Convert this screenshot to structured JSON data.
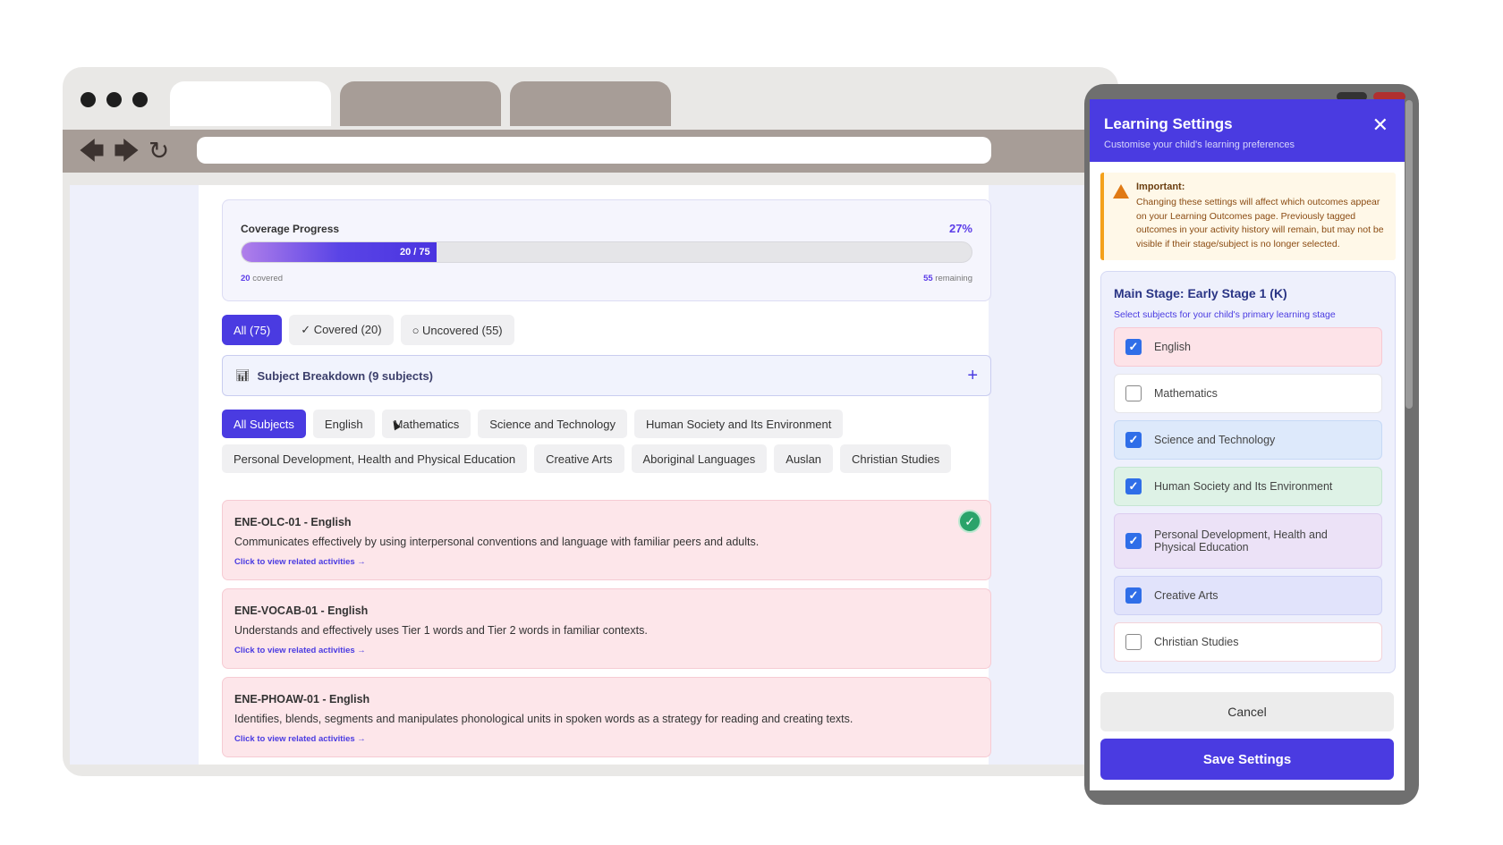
{
  "browser": {
    "nav_icons": {
      "back": "back-arrow-icon",
      "forward": "forward-arrow-icon",
      "reload": "reload-icon"
    }
  },
  "progress": {
    "title": "Coverage Progress",
    "percent_label": "27%",
    "bar_label": "20 / 75",
    "covered": 20,
    "total": 75,
    "covered_count": "20",
    "covered_text": "covered",
    "remaining_count": "55",
    "remaining_text": "remaining"
  },
  "filters": [
    {
      "label": "All (75)",
      "selected": true
    },
    {
      "label": "✓ Covered (20)",
      "selected": false
    },
    {
      "label": "○ Uncovered (55)",
      "selected": false
    }
  ],
  "breakdown": {
    "label": "Subject Breakdown (9 subjects)",
    "icon": "bar-chart-icon",
    "expand_icon": "plus-icon"
  },
  "subjects": [
    {
      "label": "All Subjects",
      "selected": true
    },
    {
      "label": "English"
    },
    {
      "label": "Mathematics"
    },
    {
      "label": "Science and Technology"
    },
    {
      "label": "Human Society and Its Environment"
    },
    {
      "label": "Personal Development, Health and Physical Education"
    },
    {
      "label": "Creative Arts"
    },
    {
      "label": "Aboriginal Languages"
    },
    {
      "label": "Auslan"
    },
    {
      "label": "Christian Studies"
    }
  ],
  "outcomes": [
    {
      "code": "ENE-OLC-01 - English",
      "description": "Communicates effectively by using interpersonal conventions and language with familiar peers and adults.",
      "link": "Click to view related activities →",
      "covered": true
    },
    {
      "code": "ENE-VOCAB-01 - English",
      "description": "Understands and effectively uses Tier 1 words and Tier 2 words in familiar contexts.",
      "link": "Click to view related activities →",
      "covered": false
    },
    {
      "code": "ENE-PHOAW-01 - English",
      "description": "Identifies, blends, segments and manipulates phonological units in spoken words as a strategy for reading and creating texts.",
      "link": "Click to view related activities →",
      "covered": false
    }
  ],
  "modal": {
    "title": "Learning Settings",
    "subtitle": "Customise your child's learning preferences",
    "warning_title": "Important:",
    "warning_text": "Changing these settings will affect which outcomes appear on your Learning Outcomes page. Previously tagged outcomes in your activity history will remain, but may not be visible if their stage/subject is no longer selected.",
    "stage_title": "Main Stage: Early Stage 1 (K)",
    "stage_subtitle": "Select subjects for your child's primary learning stage",
    "items": [
      {
        "label": "English",
        "checked": true,
        "bg": "#fde3e8",
        "border": "#f7c9d3"
      },
      {
        "label": "Mathematics",
        "checked": false,
        "bg": "#ffffff",
        "border": "#e5e5ea"
      },
      {
        "label": "Science and Technology",
        "checked": true,
        "bg": "#dde9fb",
        "border": "#c6d9f6"
      },
      {
        "label": "Human Society and Its Environment",
        "checked": true,
        "bg": "#def2e6",
        "border": "#c5e5d2"
      },
      {
        "label": "Personal Development, Health and Physical Education",
        "checked": true,
        "bg": "#ece2f7",
        "border": "#dccdf0"
      },
      {
        "label": "Creative Arts",
        "checked": true,
        "bg": "#e1e3fb",
        "border": "#cdd1f5"
      },
      {
        "label": "Christian Studies",
        "checked": false,
        "bg": "#ffffff",
        "border": "#f3d3d9"
      }
    ],
    "cancel_label": "Cancel",
    "save_label": "Save Settings"
  },
  "colors": {
    "accent": "#4a3be1",
    "covered_badge": "#2aa36a",
    "warning": "#f4a11b"
  }
}
